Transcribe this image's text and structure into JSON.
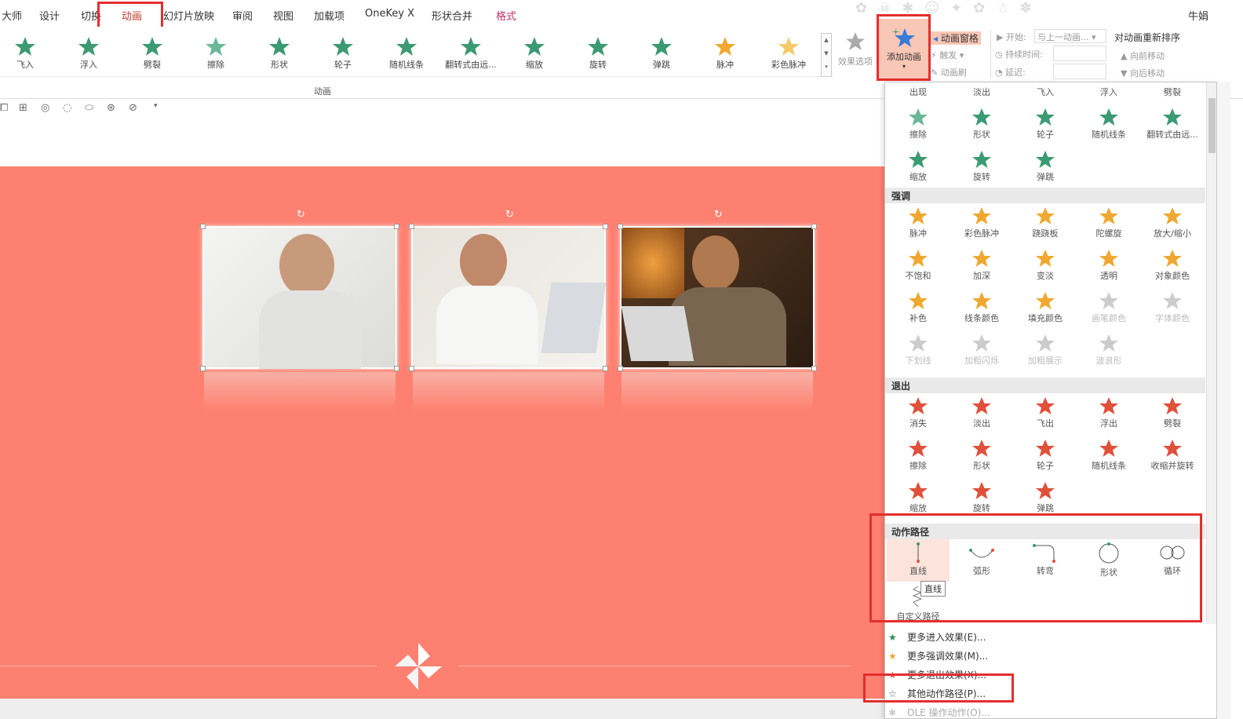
{
  "tabs": {
    "items": [
      "大师",
      "设计",
      "切换",
      "动画",
      "幻灯片放映",
      "审阅",
      "视图",
      "加载项",
      "OneKey X",
      "形状合并",
      "格式"
    ],
    "active": "动画",
    "user": "牛娟"
  },
  "ribbon": {
    "gallery": [
      "飞入",
      "浮入",
      "劈裂",
      "擦除",
      "形状",
      "轮子",
      "随机线条",
      "翻转式由远...",
      "缩放",
      "旋转",
      "弹跳",
      "脉冲",
      "彩色脉冲"
    ],
    "group_label": "动画",
    "effect_options": "效果选项",
    "add_animation": "添加动画",
    "animation_pane": "动画窗格",
    "trigger": "触发",
    "anim_painter": "动画刷",
    "start_label": "开始:",
    "start_value": "与上一动画...",
    "duration_label": "持续时间:",
    "delay_label": "延迟:",
    "reorder_title": "对动画重新排序",
    "move_earlier": "向前移动",
    "move_later": "向后移动"
  },
  "panel": {
    "entrance_top": [
      "出现",
      "淡出",
      "飞入",
      "浮入",
      "劈裂"
    ],
    "entrance": [
      "擦除",
      "形状",
      "轮子",
      "随机线条",
      "翻转式由远...",
      "缩放",
      "旋转",
      "弹跳"
    ],
    "emphasis_title": "强调",
    "emphasis": [
      "脉冲",
      "彩色脉冲",
      "跷跷板",
      "陀螺旋",
      "放大/缩小",
      "不饱和",
      "加深",
      "变淡",
      "透明",
      "对象颜色",
      "补色",
      "线条颜色",
      "填充颜色",
      "画笔颜色",
      "字体颜色",
      "下划线",
      "加粗闪烁",
      "加粗展示",
      "波浪形"
    ],
    "exit_title": "退出",
    "exit": [
      "消失",
      "淡出",
      "飞出",
      "浮出",
      "劈裂",
      "擦除",
      "形状",
      "轮子",
      "随机线条",
      "收缩并旋转",
      "缩放",
      "旋转",
      "弹跳"
    ],
    "path_title": "动作路径",
    "paths": [
      "直线",
      "弧形",
      "转弯",
      "形状",
      "循环"
    ],
    "custom_path": "自定义路径",
    "tooltip": "直线",
    "more": [
      "更多进入效果(E)...",
      "更多强调效果(M)...",
      "更多退出效果(X)...",
      "其他动作路径(P)...",
      "OLE 操作动作(O)..."
    ]
  },
  "colors": {
    "slide": "#fe8070",
    "entrance": "#3c9a73",
    "emphasis": "#f0a830",
    "exit": "#e0503a",
    "highlight": "#e52e2e"
  }
}
